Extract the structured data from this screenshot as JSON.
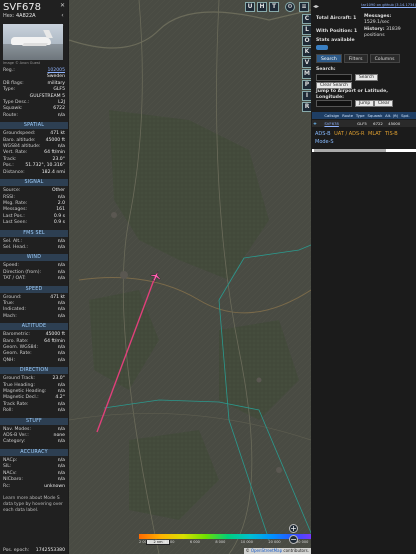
{
  "aircraft": {
    "callsign": "SVF678",
    "hex_label": "Hex:",
    "hex": "4A822A",
    "photo_credit": "Image © Anon Guest"
  },
  "details": [
    {
      "k": "Reg.:",
      "v": "102005",
      "link": true
    },
    {
      "k": "",
      "v": "Sweden"
    },
    {
      "k": "DB flags:",
      "v": "military"
    },
    {
      "k": "Type:",
      "v": "GLF5"
    },
    {
      "k": "",
      "v": "GULFSTREAM 5"
    },
    {
      "k": "Type Desc.:",
      "v": "L2J"
    },
    {
      "k": "Squawk:",
      "v": "6722"
    },
    {
      "k": "Route:",
      "v": "n/a"
    }
  ],
  "sections": {
    "spatial": {
      "title": "SPATIAL",
      "rows": [
        {
          "k": "Groundspeed:",
          "v": "471 kt"
        },
        {
          "k": "Baro. altitude:",
          "v": "45000 ft"
        },
        {
          "k": "WGS84 altitude:",
          "v": "n/a"
        },
        {
          "k": "Vert. Rate:",
          "v": "64 ft/min"
        },
        {
          "k": "Track:",
          "v": "23.0°"
        },
        {
          "k": "Pos.:",
          "v": "51.732°, 10.316°"
        },
        {
          "k": "Distance:",
          "v": "182.4 nmi"
        }
      ]
    },
    "signal": {
      "title": "SIGNAL",
      "rows": [
        {
          "k": "Source:",
          "v": "Other"
        },
        {
          "k": "RSSI:",
          "v": "n/a"
        },
        {
          "k": "Msg. Rate:",
          "v": "2.0"
        },
        {
          "k": "Messages:",
          "v": "161"
        },
        {
          "k": "",
          "v": ""
        },
        {
          "k": "Last Pos.:",
          "v": "0.9 s"
        },
        {
          "k": "Last Seen:",
          "v": "0.9 s"
        }
      ]
    },
    "fms": {
      "title": "FMS SEL",
      "rows": [
        {
          "k": "Sel. Alt.:",
          "v": "n/a"
        },
        {
          "k": "Sel. Head.:",
          "v": "n/a"
        }
      ]
    },
    "wind": {
      "title": "WIND",
      "rows": [
        {
          "k": "Speed:",
          "v": "n/a"
        },
        {
          "k": "Direction (from):",
          "v": "n/a"
        },
        {
          "k": "TAT / OAT:",
          "v": "n/a"
        }
      ]
    },
    "speed": {
      "title": "SPEED",
      "rows": [
        {
          "k": "Ground:",
          "v": "471 kt"
        },
        {
          "k": "True:",
          "v": "n/a"
        },
        {
          "k": "Indicated:",
          "v": "n/a"
        },
        {
          "k": "Mach:",
          "v": "n/a"
        }
      ]
    },
    "altitude": {
      "title": "ALTITUDE",
      "rows": [
        {
          "k": "Barometric:",
          "v": "45000 ft"
        },
        {
          "k": "Baro. Rate:",
          "v": "64 ft/min"
        },
        {
          "k": "Geom. WGS84:",
          "v": "n/a"
        },
        {
          "k": "Geom. Rate:",
          "v": "n/a"
        },
        {
          "k": "QNH:",
          "v": "n/a"
        }
      ]
    },
    "direction": {
      "title": "DIRECTION",
      "rows": [
        {
          "k": "Ground Track:",
          "v": "23.0°"
        },
        {
          "k": "True Heading:",
          "v": "n/a"
        },
        {
          "k": "Magnetic Heading:",
          "v": "n/a"
        },
        {
          "k": "Magnetic Decl.:",
          "v": "4.2°"
        },
        {
          "k": "Track Rate:",
          "v": "n/a"
        },
        {
          "k": "Roll:",
          "v": "n/a"
        }
      ]
    },
    "stuff": {
      "title": "STUFF",
      "rows": [
        {
          "k": "Nav. Modes:",
          "v": "n/a"
        },
        {
          "k": "ADS-B Ver.:",
          "v": "none"
        },
        {
          "k": "Category:",
          "v": "n/a"
        }
      ]
    },
    "accuracy": {
      "title": "ACCURACY",
      "rows": [
        {
          "k": "NACp:",
          "v": "n/a"
        },
        {
          "k": "SIL:",
          "v": "n/a"
        },
        {
          "k": "NACv:",
          "v": "n/a"
        },
        {
          "k": "NICbaro:",
          "v": "n/a"
        },
        {
          "k": "Rc:",
          "v": "unknown"
        }
      ]
    }
  },
  "learn_more": "Learn more about Mode S data type by hovering over each data label.",
  "epoch": {
    "k": "Pos. epoch:",
    "v": "1742553380"
  },
  "map": {
    "top_buttons": [
      "U",
      "H",
      "T"
    ],
    "side_buttons": [
      "C",
      "L",
      "O",
      "K",
      "V",
      "M",
      "P",
      "I",
      "R"
    ],
    "scale": "2 nm",
    "attribution_prefix": "©",
    "attribution_link": "OpenStreetMap",
    "attribution_suffix": " contributors.",
    "altitude_labels": [
      "2 000",
      "4 000",
      "6 000",
      "8 000",
      "10 000",
      "20 000",
      "30 000",
      "40 000+"
    ],
    "zoom_in": "+",
    "zoom_out": "−",
    "track_color": "#e0407a",
    "airspace_color": "#2a9a8e"
  },
  "right": {
    "top_link": "tar1090 on github (3.14.1734)",
    "stats": {
      "total_label": "Total Aircraft:",
      "total": "1",
      "messages_label": "Messages:",
      "messages": "1529.1/sec",
      "with_pos_label": "With Position:",
      "with_pos": "1",
      "history_label": "History:",
      "history": "31839 positions",
      "stats_available": "Stats available"
    },
    "tabs": [
      "Search",
      "Filters",
      "Columns"
    ],
    "search_label": "Search:",
    "search_button": "Search",
    "clear_search": "Clear Search",
    "jump_label": "Jump to Airport or Latitude, Longitude:",
    "jump_button": "Jump",
    "clear_button": "Clear",
    "table_headers": [
      "Callsign",
      "Route",
      "Type",
      "Squawk",
      "Alt. (ft)",
      "Spd."
    ],
    "table_row": {
      "callsign": "SVF678",
      "route": "",
      "type": "GLF5",
      "squawk": "6722",
      "alt": "45000"
    },
    "source_filters": [
      "ADS-B",
      "UAT / ADS-R",
      "MLAT",
      "TIS-B",
      "Mode-S"
    ]
  }
}
